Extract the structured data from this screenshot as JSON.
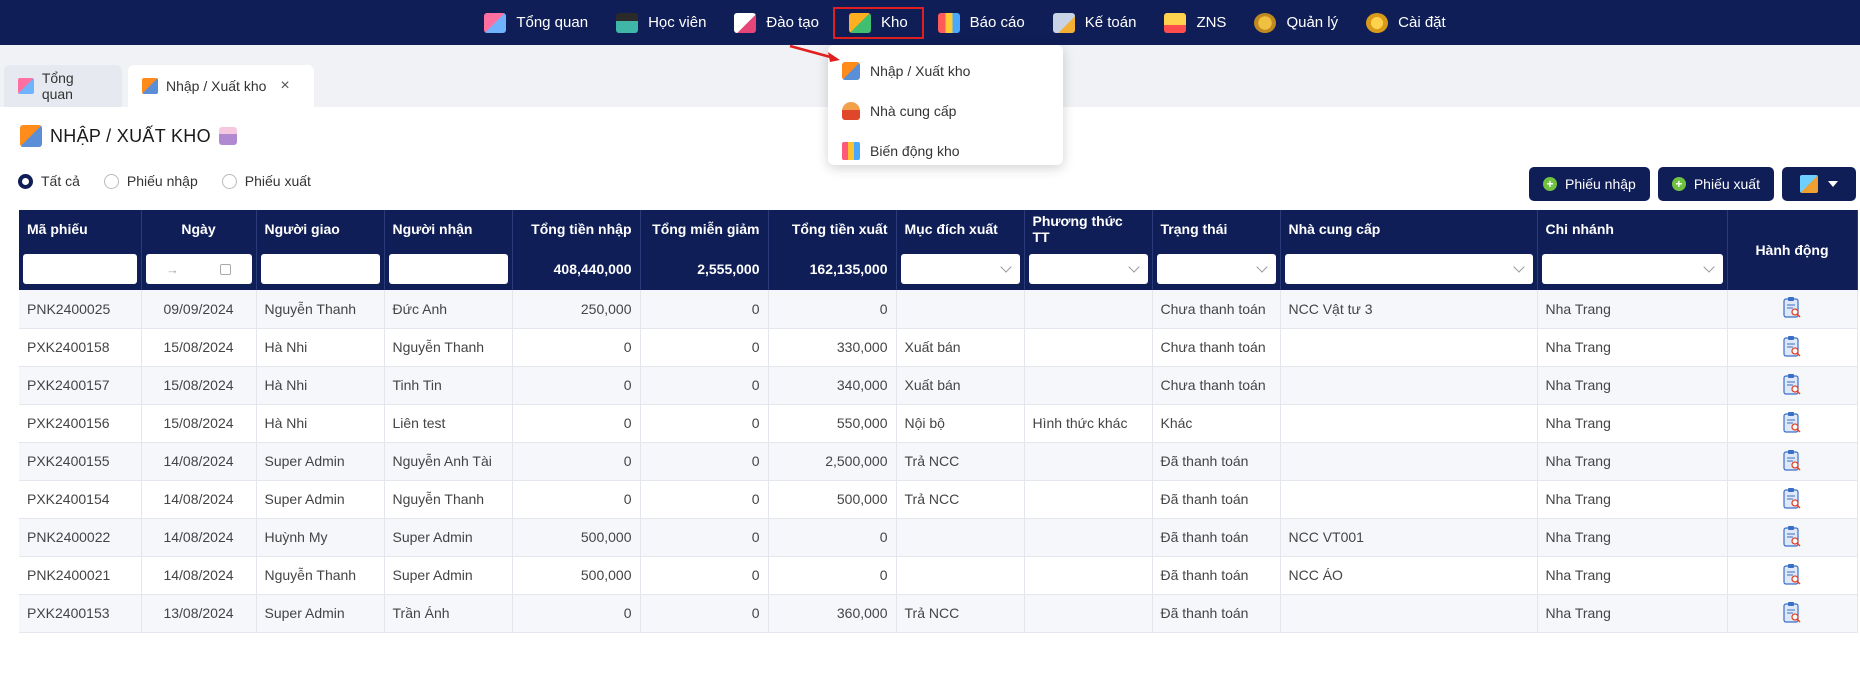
{
  "nav": {
    "items": [
      {
        "label": "Tổng quan",
        "icon": "dashboard-icon"
      },
      {
        "label": "Học viên",
        "icon": "student-icon"
      },
      {
        "label": "Đào tạo",
        "icon": "training-icon"
      },
      {
        "label": "Kho",
        "icon": "warehouse-box-icon"
      },
      {
        "label": "Báo cáo",
        "icon": "report-chart-icon"
      },
      {
        "label": "Kế toán",
        "icon": "accounting-icon"
      },
      {
        "label": "ZNS",
        "icon": "zns-mail-icon"
      },
      {
        "label": "Quản lý",
        "icon": "manage-gear-icon"
      },
      {
        "label": "Cài đặt",
        "icon": "settings-gear-icon"
      }
    ],
    "active": "Kho"
  },
  "dropdown": {
    "items": [
      {
        "label": "Nhập / Xuất kho",
        "icon": "cart-icon"
      },
      {
        "label": "Nhà cung cấp",
        "icon": "supplier-person-icon"
      },
      {
        "label": "Biến động kho",
        "icon": "stock-chart-icon"
      }
    ]
  },
  "tabs": [
    {
      "label": "Tổng quan"
    },
    {
      "label": "Nhập / Xuất kho",
      "close": "×"
    }
  ],
  "page": {
    "title": "NHẬP / XUẤT KHO"
  },
  "filters": {
    "radios": [
      "Tất cả",
      "Phiếu nhập",
      "Phiếu xuất"
    ],
    "selected": "Tất cả"
  },
  "buttons": {
    "import": "Phiếu nhập",
    "export": "Phiếu xuất"
  },
  "table": {
    "columns": [
      "Mã phiếu",
      "Ngày",
      "Người giao",
      "Người nhận",
      "Tổng tiền nhập",
      "Tổng miễn giảm",
      "Tổng tiền xuất",
      "Mục đích xuất",
      "Phương thức TT",
      "Trạng thái",
      "Nhà cung cấp",
      "Chi nhánh",
      "Hành động"
    ],
    "totals": {
      "import_total": "408,440,000",
      "discount_total": "2,555,000",
      "export_total": "162,135,000"
    },
    "date_range_arrow": "→",
    "rows": [
      [
        "PNK2400025",
        "09/09/2024",
        "Nguyễn Thanh",
        "Đức Anh",
        "250,000",
        "0",
        "0",
        "",
        "",
        "Chưa thanh toán",
        "NCC Vật tư 3",
        "Nha Trang"
      ],
      [
        "PXK2400158",
        "15/08/2024",
        "Hà Nhi",
        "Nguyễn Thanh",
        "0",
        "0",
        "330,000",
        "Xuất bán",
        "",
        "Chưa thanh toán",
        "",
        "Nha Trang"
      ],
      [
        "PXK2400157",
        "15/08/2024",
        "Hà Nhi",
        "Tinh Tin",
        "0",
        "0",
        "340,000",
        "Xuất bán",
        "",
        "Chưa thanh toán",
        "",
        "Nha Trang"
      ],
      [
        "PXK2400156",
        "15/08/2024",
        "Hà Nhi",
        "Liên test",
        "0",
        "0",
        "550,000",
        "Nội bộ",
        "Hình thức khác",
        "Khác",
        "",
        "Nha Trang"
      ],
      [
        "PXK2400155",
        "14/08/2024",
        "Super Admin",
        "Nguyễn Anh Tài",
        "0",
        "0",
        "2,500,000",
        "Trả NCC",
        "",
        "Đã thanh toán",
        "",
        "Nha Trang"
      ],
      [
        "PXK2400154",
        "14/08/2024",
        "Super Admin",
        "Nguyễn Thanh",
        "0",
        "0",
        "500,000",
        "Trả NCC",
        "",
        "Đã thanh toán",
        "",
        "Nha Trang"
      ],
      [
        "PNK2400022",
        "14/08/2024",
        "Huỳnh My",
        "Super Admin",
        "500,000",
        "0",
        "0",
        "",
        "",
        "Đã thanh toán",
        "NCC VT001",
        "Nha Trang"
      ],
      [
        "PNK2400021",
        "14/08/2024",
        "Nguyễn Thanh",
        "Super Admin",
        "500,000",
        "0",
        "0",
        "",
        "",
        "Đã thanh toán",
        "NCC ÁO",
        "Nha Trang"
      ],
      [
        "PXK2400153",
        "13/08/2024",
        "Super Admin",
        "Trần Ánh",
        "0",
        "0",
        "360,000",
        "Trả NCC",
        "",
        "Đã thanh toán",
        "",
        "Nha Trang"
      ]
    ]
  }
}
